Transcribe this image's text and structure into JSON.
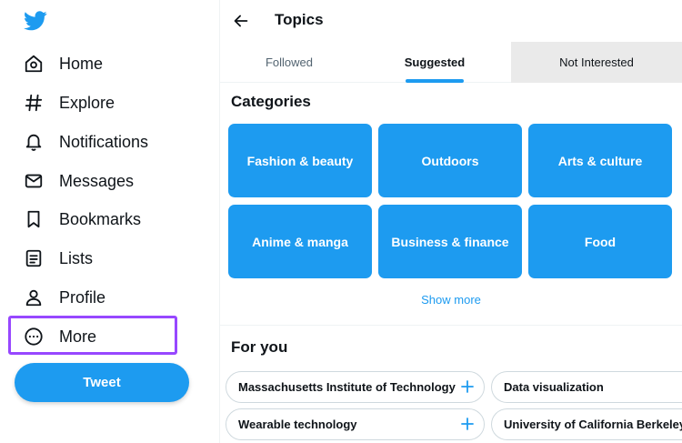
{
  "sidebar": {
    "logo_icon": "twitter-bird-icon",
    "items": [
      {
        "label": "Home",
        "icon": "home-icon"
      },
      {
        "label": "Explore",
        "icon": "hashtag-icon"
      },
      {
        "label": "Notifications",
        "icon": "bell-icon"
      },
      {
        "label": "Messages",
        "icon": "envelope-icon"
      },
      {
        "label": "Bookmarks",
        "icon": "bookmark-icon"
      },
      {
        "label": "Lists",
        "icon": "list-icon"
      },
      {
        "label": "Profile",
        "icon": "person-icon"
      },
      {
        "label": "More",
        "icon": "more-circle-icon"
      }
    ],
    "tweet_label": "Tweet"
  },
  "header": {
    "back_icon": "arrow-left-icon",
    "title": "Topics"
  },
  "tabs": [
    {
      "label": "Followed"
    },
    {
      "label": "Suggested",
      "active": true
    },
    {
      "label": "Not Interested"
    }
  ],
  "categories": {
    "title": "Categories",
    "items": [
      "Fashion & beauty",
      "Outdoors",
      "Arts & culture",
      "Anime & manga",
      "Business & finance",
      "Food"
    ],
    "show_more": "Show more"
  },
  "for_you": {
    "title": "For you",
    "topics": [
      "Massachusetts Institute of Technology",
      "Data visualization",
      "Wearable technology",
      "University of California Berkeley"
    ]
  },
  "colors": {
    "accent": "#1d9bf0",
    "highlight": "#9747ff",
    "text": "#0f1419",
    "secondary_text": "#536471"
  }
}
